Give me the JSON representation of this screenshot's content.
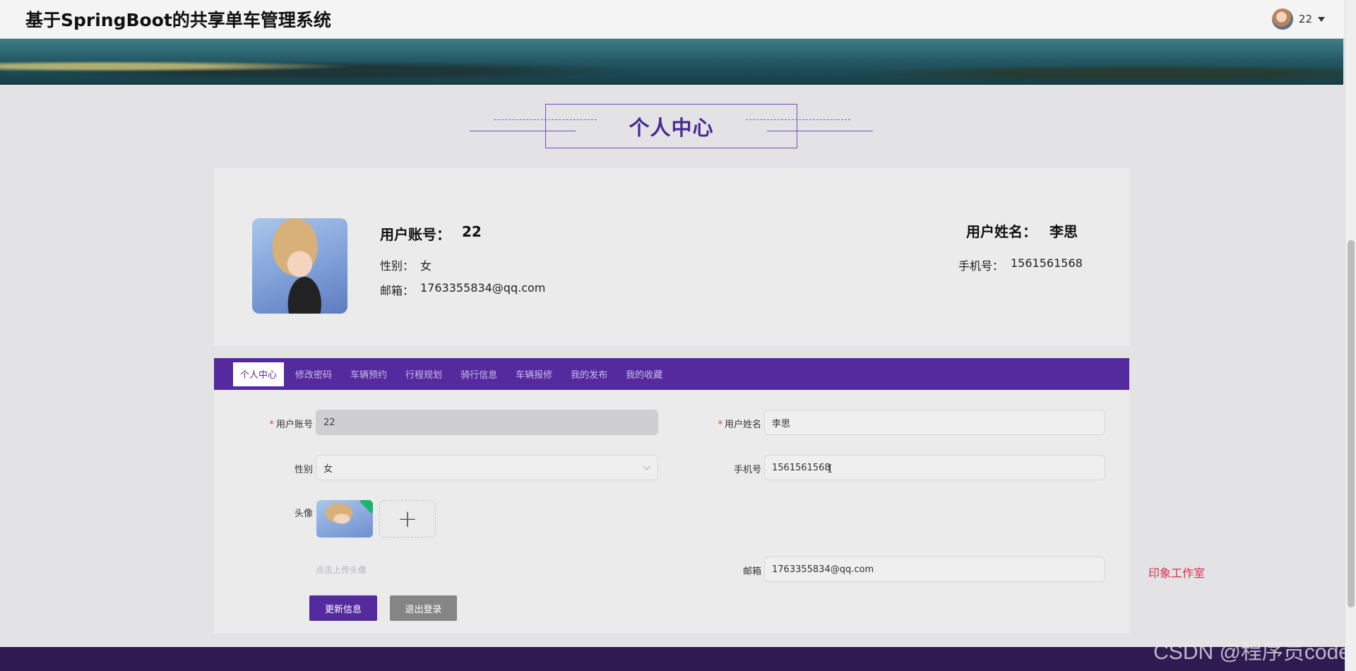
{
  "app": {
    "title": "基于SpringBoot的共享单车管理系统",
    "user_name": "22"
  },
  "section": {
    "heading": "个人中心"
  },
  "profile": {
    "account_label": "用户账号：",
    "account_value": "22",
    "name_label": "用户姓名：",
    "name_value": "李思",
    "gender_label": "性别：",
    "gender_value": "女",
    "phone_label": "手机号：",
    "phone_value": "1561561568",
    "email_label": "邮箱：",
    "email_value": "1763355834@qq.com"
  },
  "tabs": [
    {
      "label": "个人中心",
      "active": true
    },
    {
      "label": "修改密码",
      "active": false
    },
    {
      "label": "车辆预约",
      "active": false
    },
    {
      "label": "行程规划",
      "active": false
    },
    {
      "label": "骑行信息",
      "active": false
    },
    {
      "label": "车辆报修",
      "active": false
    },
    {
      "label": "我的发布",
      "active": false
    },
    {
      "label": "我的收藏",
      "active": false
    }
  ],
  "form": {
    "required_mark": "*",
    "account_label": "用户账号",
    "account_value": "22",
    "name_label": "用户姓名",
    "name_value": "李思",
    "gender_label": "性别",
    "gender_value": "女",
    "phone_label": "手机号",
    "phone_value": "1561561568",
    "avatar_label": "头像",
    "upload_plus": "+",
    "upload_hint": "点击上传头像",
    "email_label": "邮箱",
    "email_value": "1763355834@qq.com",
    "update_button": "更新信息",
    "logout_button": "退出登录"
  },
  "side_note": "印象工作室",
  "watermark": "CSDN @程序员code",
  "text_cursor": "I",
  "colors": {
    "brand_purple": "#552a9f",
    "footer": "#301a52",
    "note_red": "#d5304c"
  },
  "icons": {
    "user_menu": "chevron-down-icon",
    "select": "chevron-down-icon",
    "upload": "plus-icon",
    "uploaded": "check-icon"
  }
}
